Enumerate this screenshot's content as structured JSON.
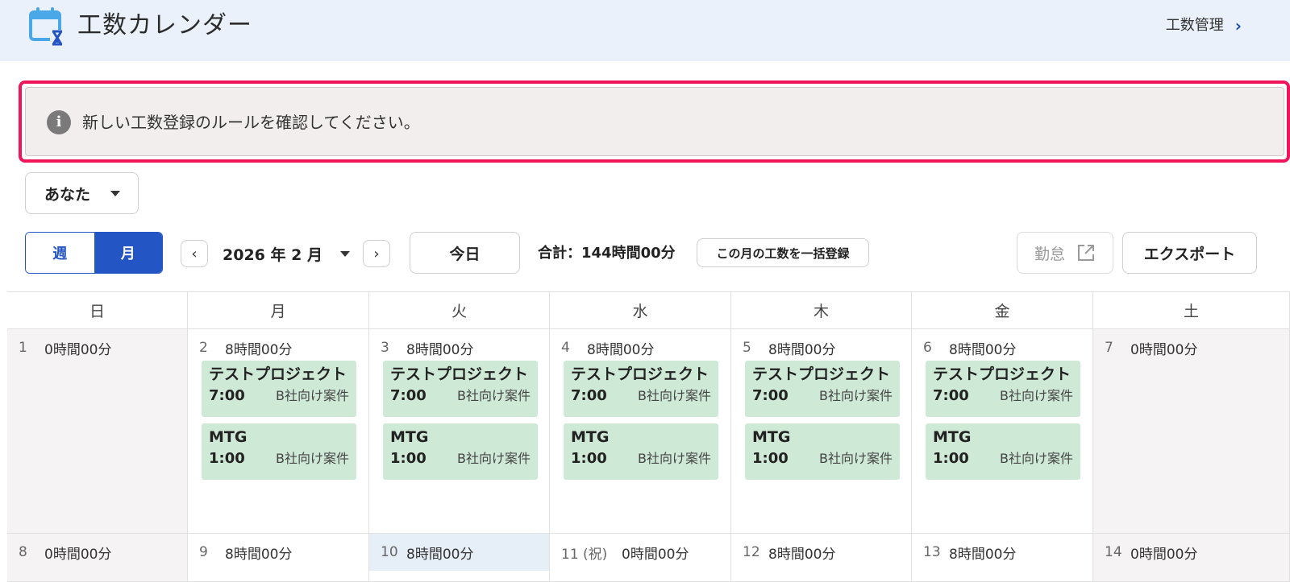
{
  "header": {
    "title": "工数カレンダー",
    "management_link": "工数管理",
    "chevron": "›"
  },
  "alert": {
    "icon": "info-icon",
    "icon_glyph": "i",
    "message": "新しい工数登録のルールを確認してください。"
  },
  "user_select": {
    "value": "あなた"
  },
  "toolbar": {
    "view_week": "週",
    "view_month": "月",
    "active_view": "month",
    "prev": "‹",
    "next": "›",
    "current_month": "2026 年 2 月",
    "today": "今日",
    "total": "合計：144時間00分",
    "bulk_register": "この月の工数を一括登録",
    "attendance": "勤怠",
    "export": "エクスポート"
  },
  "calendar": {
    "weekdays": [
      "日",
      "月",
      "火",
      "水",
      "木",
      "金",
      "土"
    ],
    "week1": [
      {
        "num": "1",
        "hours": "0時間00分",
        "entries": []
      },
      {
        "num": "2",
        "hours": "8時間00分",
        "entries": [
          {
            "name": "テストプロジェクト",
            "time": "7:00",
            "project": "B社向け案件"
          },
          {
            "name": "MTG",
            "time": "1:00",
            "project": "B社向け案件"
          }
        ]
      },
      {
        "num": "3",
        "hours": "8時間00分",
        "entries": [
          {
            "name": "テストプロジェクト",
            "time": "7:00",
            "project": "B社向け案件"
          },
          {
            "name": "MTG",
            "time": "1:00",
            "project": "B社向け案件"
          }
        ]
      },
      {
        "num": "4",
        "hours": "8時間00分",
        "entries": [
          {
            "name": "テストプロジェクト",
            "time": "7:00",
            "project": "B社向け案件"
          },
          {
            "name": "MTG",
            "time": "1:00",
            "project": "B社向け案件"
          }
        ]
      },
      {
        "num": "5",
        "hours": "8時間00分",
        "entries": [
          {
            "name": "テストプロジェクト",
            "time": "7:00",
            "project": "B社向け案件"
          },
          {
            "name": "MTG",
            "time": "1:00",
            "project": "B社向け案件"
          }
        ]
      },
      {
        "num": "6",
        "hours": "8時間00分",
        "entries": [
          {
            "name": "テストプロジェクト",
            "time": "7:00",
            "project": "B社向け案件"
          },
          {
            "name": "MTG",
            "time": "1:00",
            "project": "B社向け案件"
          }
        ]
      },
      {
        "num": "7",
        "hours": "0時間00分",
        "entries": []
      }
    ],
    "week2": [
      {
        "num": "8",
        "hours": "0時間00分"
      },
      {
        "num": "9",
        "hours": "8時間00分"
      },
      {
        "num": "10",
        "hours": "8時間00分",
        "today": true
      },
      {
        "num": "11 (祝)",
        "hours": "0時間00分"
      },
      {
        "num": "12",
        "hours": "8時間00分"
      },
      {
        "num": "13",
        "hours": "8時間00分"
      },
      {
        "num": "14",
        "hours": "0時間00分"
      }
    ]
  },
  "colors": {
    "primary": "#2356c4",
    "highlight_border": "#f0145a",
    "entry_bg": "#cfe9d7",
    "header_bg": "#eaf1fb"
  }
}
